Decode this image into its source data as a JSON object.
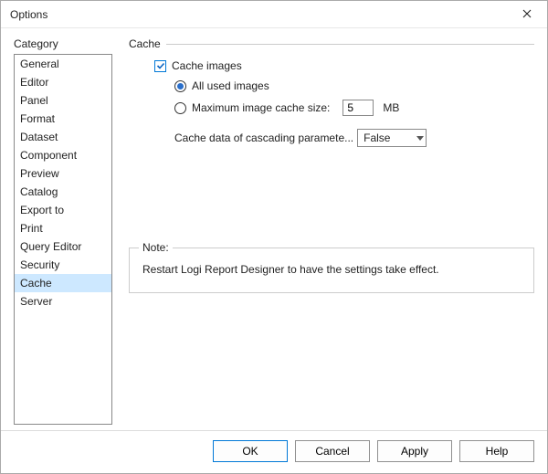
{
  "window": {
    "title": "Options"
  },
  "sidebar": {
    "label": "Category",
    "items": [
      "General",
      "Editor",
      "Panel",
      "Format",
      "Dataset",
      "Component",
      "Preview",
      "Catalog",
      "Export to",
      "Print",
      "Query Editor",
      "Security",
      "Cache",
      "Server"
    ],
    "selected": "Cache"
  },
  "main": {
    "section_title": "Cache",
    "cache_images_label": "Cache images",
    "cache_images_checked": true,
    "radio_all_label": "All used images",
    "radio_max_label": "Maximum image cache size:",
    "radio_selected": "all",
    "size_value": "5",
    "size_unit": "MB",
    "param_label": "Cache data of cascading paramete...",
    "param_value": "False",
    "note_legend": "Note:",
    "note_text": "Restart Logi Report Designer to have the settings take effect."
  },
  "footer": {
    "ok": "OK",
    "cancel": "Cancel",
    "apply": "Apply",
    "help": "Help"
  }
}
